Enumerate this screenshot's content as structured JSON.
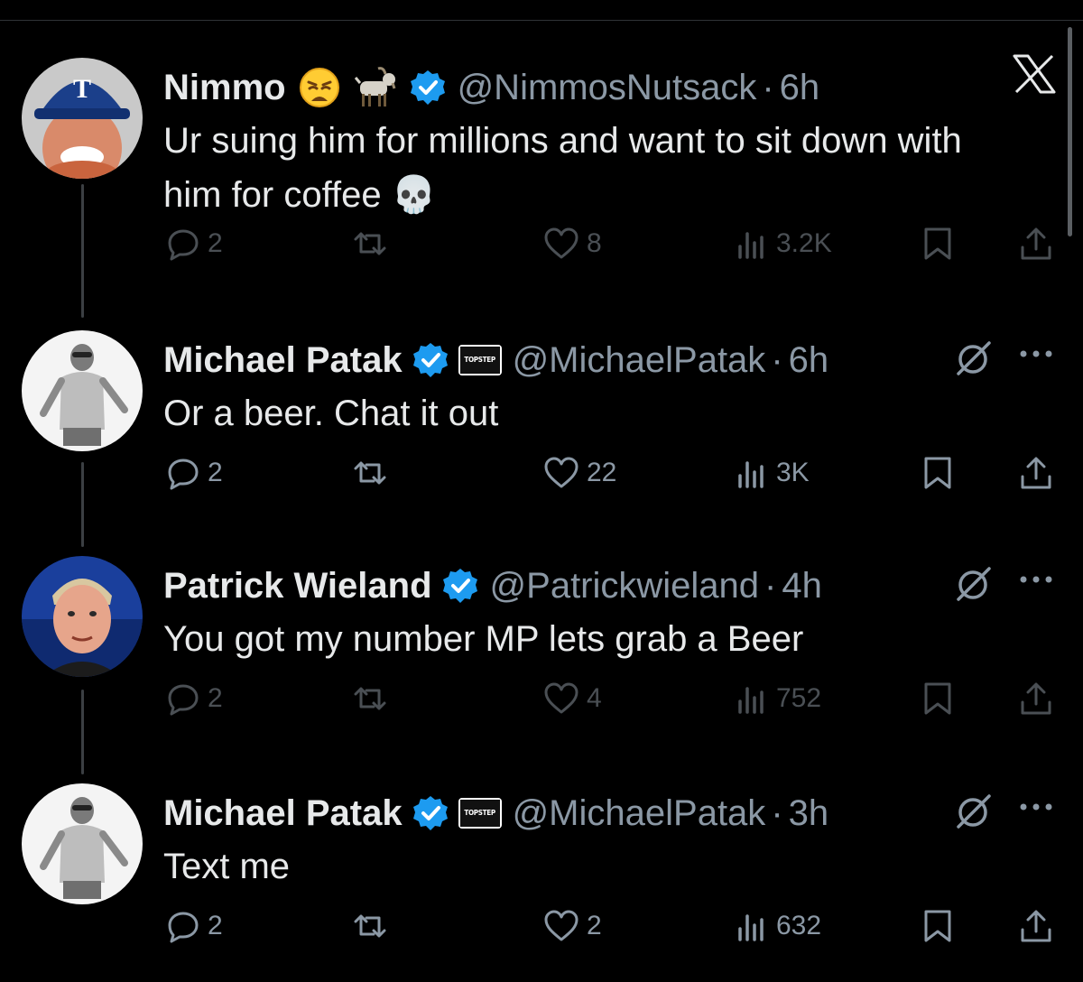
{
  "tweets": [
    {
      "name": "Nimmo",
      "emojis": [
        "😩",
        "🐐"
      ],
      "verified": true,
      "affiliation": "",
      "handle": "@NimmosNutsack",
      "time": "6h",
      "text": "Ur suing him for millions and want to sit down with him for coffee 💀",
      "replies": "2",
      "likes": "8",
      "views": "3.2K",
      "dimmed": true,
      "corner_icon": "x-logo-icon"
    },
    {
      "name": "Michael Patak",
      "emojis": [],
      "verified": true,
      "affiliation": "TOPSTEP",
      "handle": "@MichaelPatak",
      "time": "6h",
      "text": "Or a beer. Chat it out",
      "replies": "2",
      "likes": "22",
      "views": "3K",
      "dimmed": false,
      "corner_icon": "grok-icon"
    },
    {
      "name": "Patrick Wieland",
      "emojis": [],
      "verified": true,
      "affiliation": "",
      "handle": "@Patrickwieland",
      "time": "4h",
      "text": "You got my number MP lets grab a Beer",
      "replies": "2",
      "likes": "4",
      "views": "752",
      "dimmed": true,
      "corner_icon": "grok-icon"
    },
    {
      "name": "Michael Patak",
      "emojis": [],
      "verified": true,
      "affiliation": "TOPSTEP",
      "handle": "@MichaelPatak",
      "time": "3h",
      "text": "Text me",
      "replies": "2",
      "likes": "2",
      "views": "632",
      "dimmed": false,
      "corner_icon": "grok-icon"
    }
  ],
  "colors": {
    "background": "#000000",
    "text": "#e7e9ea",
    "muted": "#8b98a5",
    "dim": "#4a4f54",
    "verified": "#1d9bf0",
    "divider": "#2f3336"
  }
}
